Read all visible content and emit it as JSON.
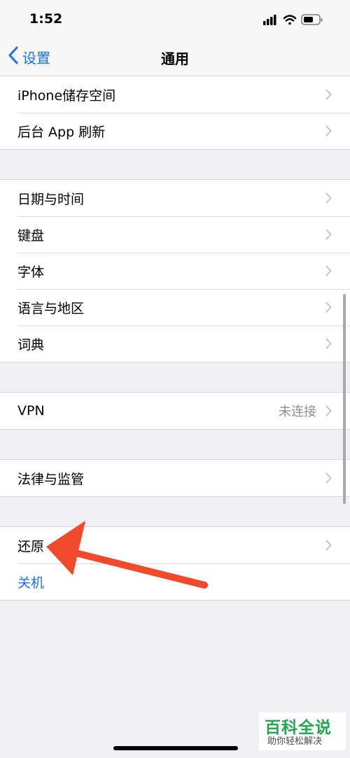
{
  "status_bar": {
    "time": "1:52",
    "icons": [
      "signal-icon",
      "wifi-icon",
      "battery-icon"
    ]
  },
  "nav": {
    "back_label": "设置",
    "title": "通用"
  },
  "groups": [
    {
      "rows": [
        {
          "label": "iPhone储存空间"
        },
        {
          "label": "后台 App 刷新"
        }
      ]
    },
    {
      "rows": [
        {
          "label": "日期与时间"
        },
        {
          "label": "键盘"
        },
        {
          "label": "字体"
        },
        {
          "label": "语言与地区"
        },
        {
          "label": "词典"
        }
      ]
    },
    {
      "rows": [
        {
          "label": "VPN",
          "value": "未连接"
        }
      ]
    },
    {
      "rows": [
        {
          "label": "法律与监管"
        }
      ]
    },
    {
      "rows": [
        {
          "label": "还原"
        },
        {
          "label": "关机"
        }
      ]
    }
  ],
  "watermark": {
    "title": "百科全说",
    "subtitle": "助你轻松解决"
  },
  "colors": {
    "accent": "#1a73e8",
    "annotation_arrow": "#f0492c",
    "watermark_green": "#19a24a"
  }
}
